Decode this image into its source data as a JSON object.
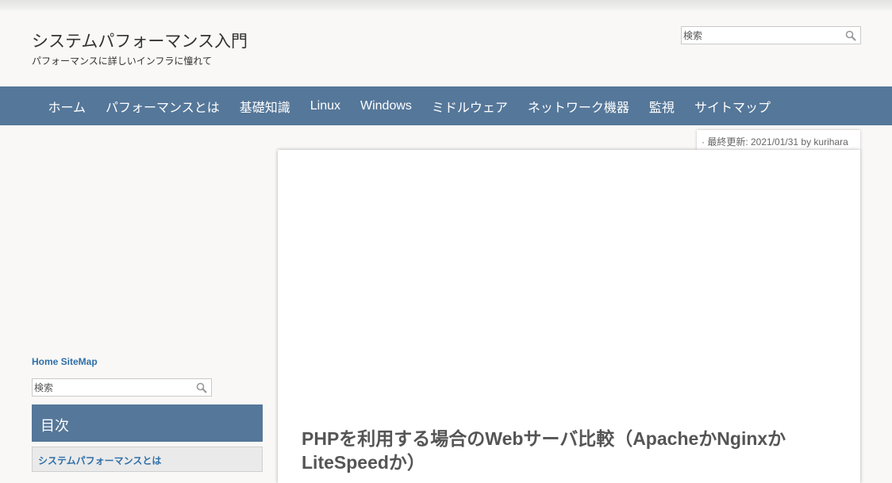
{
  "header": {
    "title": "システムパフォーマンス入門",
    "tagline": "パフォーマンスに詳しいインフラに憧れて",
    "search_placeholder": "検索"
  },
  "nav": {
    "items": [
      "ホーム",
      "パフォーマンスとは",
      "基礎知識",
      "Linux",
      "Windows",
      "ミドルウェア",
      "ネットワーク機器",
      "監視",
      "サイトマップ"
    ]
  },
  "sidebar": {
    "links": "Home SiteMap",
    "search_placeholder": "検索",
    "toc_title": "目次",
    "toc_items": [
      "システムパフォーマンスとは"
    ]
  },
  "article": {
    "meta": "· 最終更新: 2021/01/31 by kurihara",
    "title": "PHPを利用する場合のWebサーバ比較（ApacheかNginxかLiteSpeedか）"
  },
  "colors": {
    "nav": "#557799",
    "link": "#2f6fa8"
  }
}
